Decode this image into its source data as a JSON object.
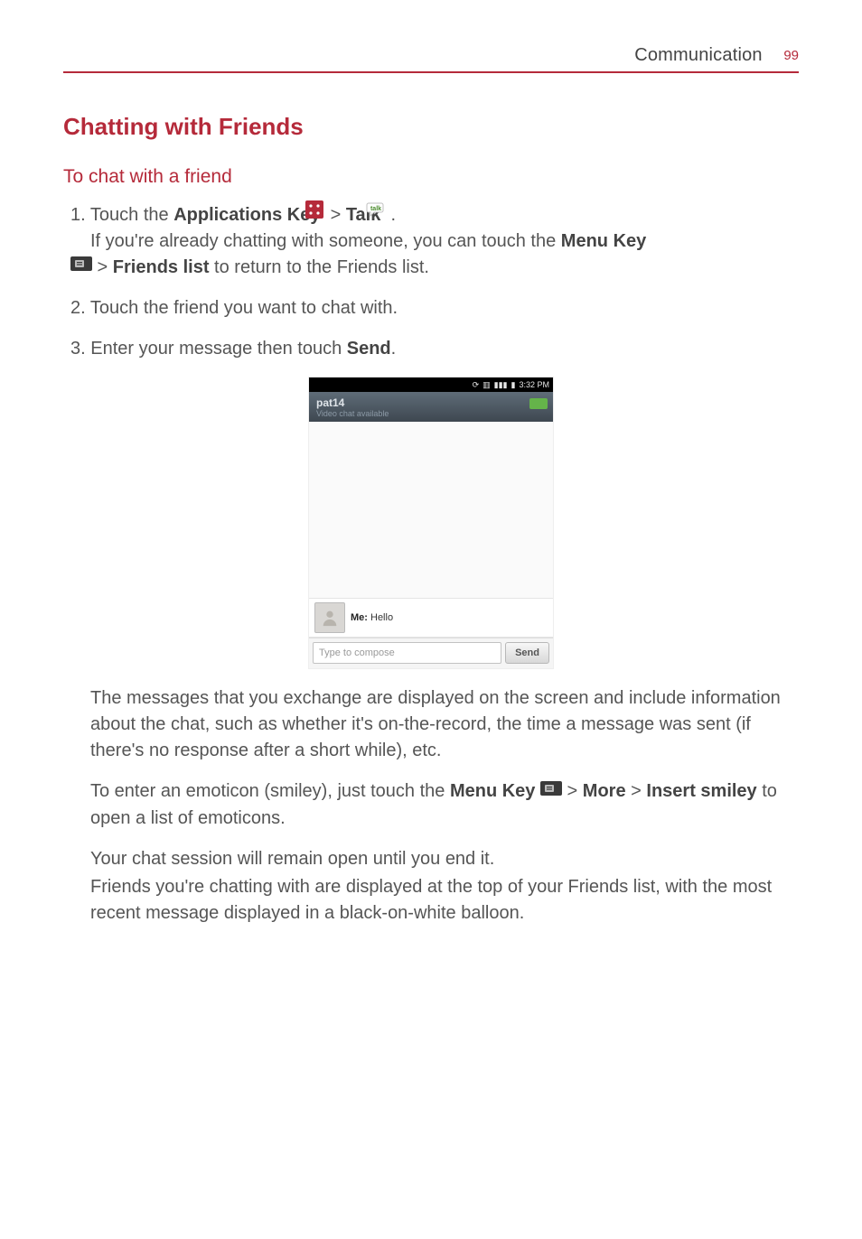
{
  "header": {
    "title": "Communication",
    "page": "99"
  },
  "h1": "Chatting with Friends",
  "h2": "To chat with a friend",
  "steps": {
    "s1_n": "1.",
    "s1_a": "Touch the ",
    "s1_b": "Applications Key",
    "s1_c": " > ",
    "s1_d": "Talk",
    "s1_e": " .",
    "s1_line2a": "If you're already chatting with someone, you can touch the ",
    "s1_line2b": "Menu Key",
    "s1_line3a": " > ",
    "s1_line3b": "Friends list",
    "s1_line3c": " to return to the Friends list.",
    "s2_n": "2.",
    "s2": "Touch the friend you want to chat with.",
    "s3_n": "3.",
    "s3a": "Enter your message then touch ",
    "s3b": "Send",
    "s3c": "."
  },
  "shot": {
    "time": "3:32 PM",
    "name": "pat14",
    "sub": "Video chat available",
    "msg_label": "Me: ",
    "msg_text": "Hello",
    "compose_ph": "Type to compose",
    "send": "Send"
  },
  "body": {
    "p1": "The messages that you exchange are displayed on the screen and include information about the chat, such as whether it's on-the-record, the time a message was sent (if there's no response after a short while), etc.",
    "p2a": "To enter an emoticon (smiley), just touch the ",
    "p2b": "Menu Key",
    "p2c": " > ",
    "p2d": "More",
    "p2e": " > ",
    "p2f": "Insert smiley",
    "p2g": " to open a list of emoticons.",
    "p3": "Your chat session will remain open until you end it.",
    "p4": "Friends you're chatting with are displayed at the top of your Friends list, with the most recent message displayed in a black-on-white balloon."
  }
}
